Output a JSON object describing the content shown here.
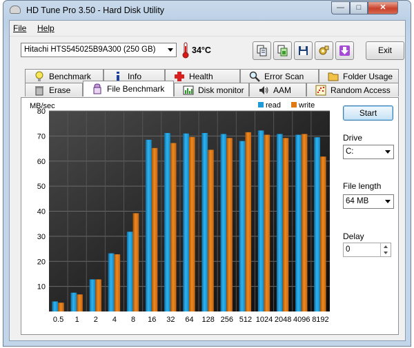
{
  "window": {
    "title": "HD Tune Pro 3.50 - Hard Disk Utility",
    "minimize_label": "—",
    "maximize_label": "□",
    "close_label": "✕"
  },
  "menu": {
    "file": "File",
    "help": "Help"
  },
  "toolbar": {
    "drive": "Hitachi HTS545025B9A300 (250 GB)",
    "temperature": "34°C",
    "exit_label": "Exit",
    "icons": [
      "copy-text-icon",
      "copy-screenshot-icon",
      "save-icon",
      "options-icon",
      "download-icon"
    ]
  },
  "tabs_row1": [
    {
      "label": "Benchmark",
      "icon": "bulb-icon"
    },
    {
      "label": "Info",
      "icon": "info-icon"
    },
    {
      "label": "Health",
      "icon": "health-cross-icon"
    },
    {
      "label": "Error Scan",
      "icon": "magnifier-icon"
    },
    {
      "label": "Folder Usage",
      "icon": "folder-icon"
    }
  ],
  "tabs_row2": [
    {
      "label": "Erase",
      "icon": "trash-icon"
    },
    {
      "label": "File Benchmark",
      "icon": "file-benchmark-icon",
      "active": true
    },
    {
      "label": "Disk monitor",
      "icon": "monitor-chart-icon"
    },
    {
      "label": "AAM",
      "icon": "speaker-icon"
    },
    {
      "label": "Random Access",
      "icon": "random-dots-icon"
    }
  ],
  "side": {
    "start_label": "Start",
    "drive_label": "Drive",
    "drive_value": "C:",
    "file_length_label": "File length",
    "file_length_value": "64 MB",
    "delay_label": "Delay",
    "delay_value": "0"
  },
  "chart_data": {
    "type": "bar",
    "ylabel": "MB/sec",
    "ylim": [
      0,
      80
    ],
    "yticks": [
      10,
      20,
      30,
      40,
      50,
      60,
      70,
      80
    ],
    "categories": [
      "0.5",
      "1",
      "2",
      "4",
      "8",
      "16",
      "32",
      "64",
      "128",
      "256",
      "512",
      "1024",
      "2048",
      "4096",
      "8192"
    ],
    "series": [
      {
        "name": "read",
        "color": "#1e9bd7",
        "values": [
          4,
          7.5,
          12.8,
          23.2,
          31.8,
          68.5,
          71.2,
          71,
          71.2,
          70.8,
          68,
          72.2,
          70.8,
          70.5,
          69.5
        ]
      },
      {
        "name": "write",
        "color": "#e07a10",
        "values": [
          3.5,
          6.8,
          12.8,
          22.8,
          39.2,
          65.2,
          67.2,
          69.6,
          64.5,
          69.2,
          71.5,
          70.5,
          69.2,
          70.8,
          61.8
        ]
      }
    ],
    "grid": true,
    "legend": "top-right"
  }
}
